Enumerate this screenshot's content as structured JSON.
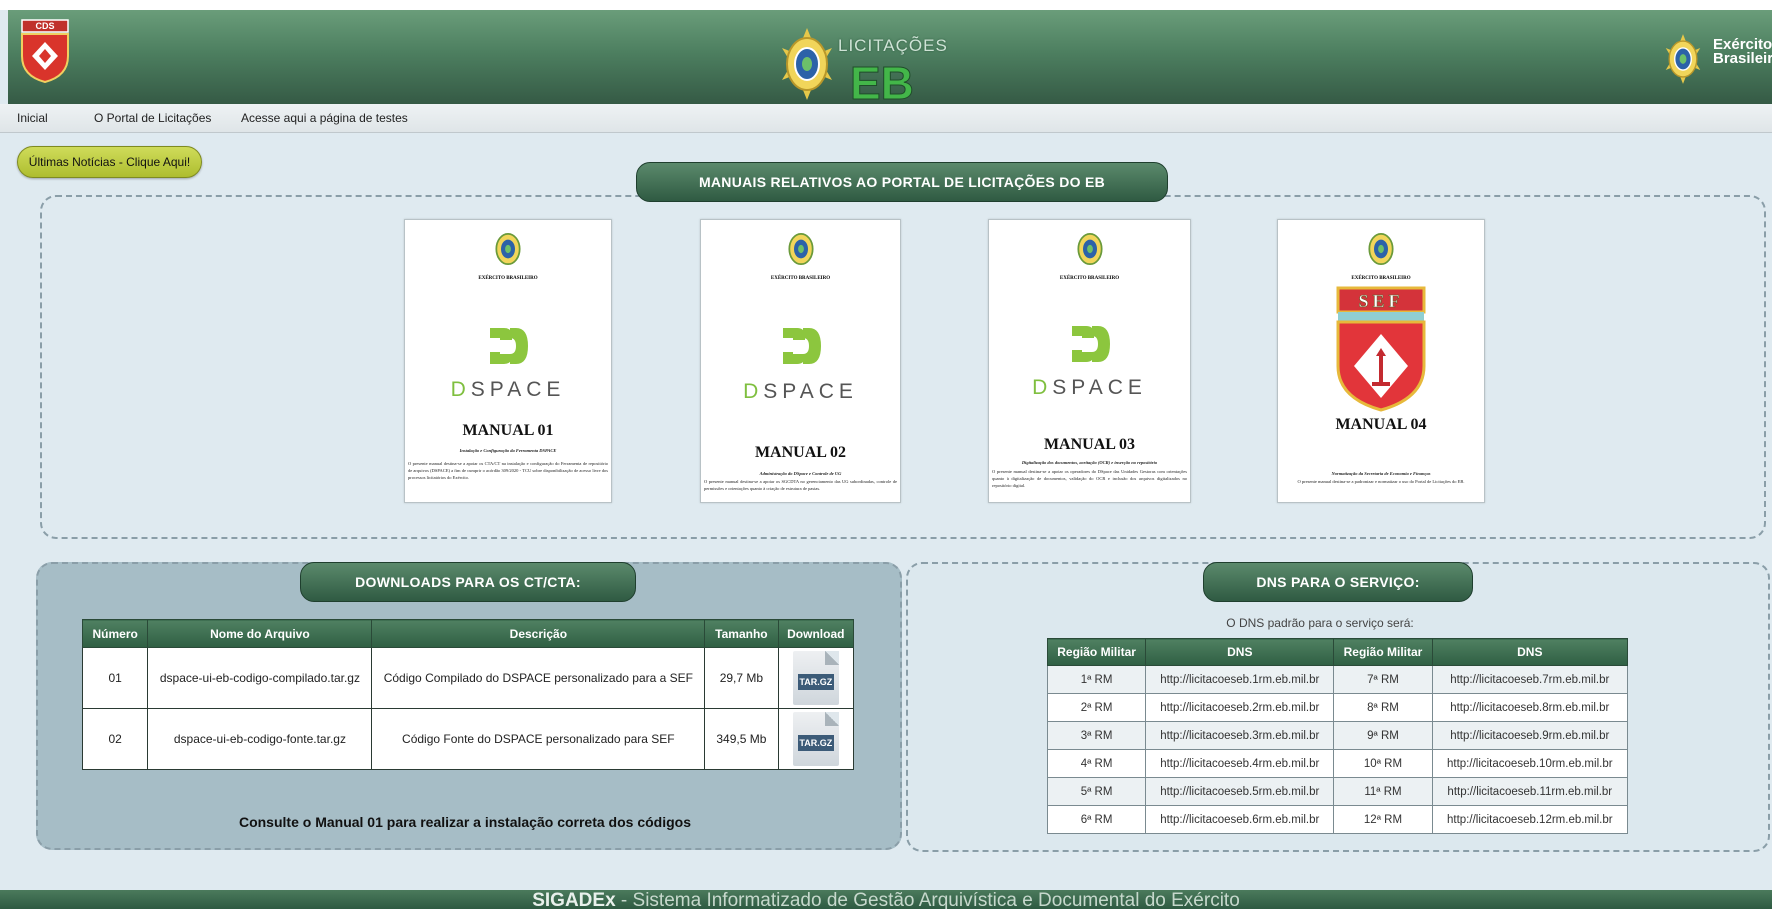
{
  "header": {
    "cds_logo_text": "CDS",
    "brand_small": "LICITAÇÕES",
    "brand_big": "EB",
    "exercito_line1": "Exército",
    "exercito_line2": "Brasileiro"
  },
  "nav": {
    "items": [
      "Inicial",
      "O Portal de Licitações",
      "Acesse aqui a página de testes"
    ]
  },
  "news_button": "Últimas Notícias - Clique Aqui!",
  "manuals": {
    "title": "MANUAIS RELATIVOS AO PORTAL DE LICITAÇÕES DO EB",
    "cards": [
      {
        "header": "EXÉRCITO BRASILEIRO",
        "logo": "DSPACE",
        "title": "MANUAL 01",
        "subtitle": "Instalação e Configuração da Ferramenta DSPACE",
        "description": "O presente manual destina-se a apoiar os CTA/CT na instalação e configuração do Ferramenta de repositório de arquivos (DSPACE) a fim de cumprir o acórdão 309/2020 - TCU sobre disponibilização de acesso livre dos processos licitatórios do Exército."
      },
      {
        "header": "EXÉRCITO BRASILEIRO",
        "logo": "DSPACE",
        "title": "MANUAL 02",
        "subtitle": "Administração do DSpace e Controle de UG",
        "description": "O presente manual destina-se a apoiar os SGCDTA no gerenciamento das UG subordinadas, controle de permissões e orientações quanto à criação de estrutura de pastas."
      },
      {
        "header": "EXÉRCITO BRASILEIRO",
        "logo": "DSPACE",
        "title": "MANUAL 03",
        "subtitle": "Digitalização dos documentos, aceitação (OCR) e inserção no repositório",
        "description": "O presente manual destina-se a apoiar os operadores do DSpace das Unidades Gestoras com orientações quanto à digitalização de documentos, validação do OCR e inclusão dos arquivos digitalizados no repositório digital."
      },
      {
        "header": "EXÉRCITO BRASILEIRO",
        "logo": "SEF",
        "title": "MANUAL 04",
        "subtitle": "Normatização da Secretaria de Economia e Finanças",
        "description": "O presente manual destina-se a padronizar e normatizar o uso do Portal de Licitações do EB."
      }
    ]
  },
  "downloads": {
    "title": "DOWNLOADS PARA OS CT/CTA:",
    "columns": [
      "Número",
      "Nome do Arquivo",
      "Descrição",
      "Tamanho",
      "Download"
    ],
    "rows": [
      [
        "01",
        "dspace-ui-eb-codigo-compilado.tar.gz",
        "Código Compilado do DSPACE personalizado para a SEF",
        "29,7 Mb",
        "TAR.GZ"
      ],
      [
        "02",
        "dspace-ui-eb-codigo-fonte.tar.gz",
        "Código Fonte do DSPACE personalizado para SEF",
        "349,5 Mb",
        "TAR.GZ"
      ]
    ],
    "note": "Consulte o Manual 01 para realizar a instalação correta dos códigos"
  },
  "dns": {
    "title": "DNS PARA O SERVIÇO:",
    "intro": "O DNS padrão para o serviço será:",
    "columns": [
      "Região Militar",
      "DNS",
      "Região Militar",
      "DNS"
    ],
    "rows": [
      [
        "1ª RM",
        "http://licitacoeseb.1rm.eb.mil.br",
        "7ª RM",
        "http://licitacoeseb.7rm.eb.mil.br"
      ],
      [
        "2ª RM",
        "http://licitacoeseb.2rm.eb.mil.br",
        "8ª RM",
        "http://licitacoeseb.8rm.eb.mil.br"
      ],
      [
        "3ª RM",
        "http://licitacoeseb.3rm.eb.mil.br",
        "9ª RM",
        "http://licitacoeseb.9rm.eb.mil.br"
      ],
      [
        "4ª RM",
        "http://licitacoeseb.4rm.eb.mil.br",
        "10ª RM",
        "http://licitacoeseb.10rm.eb.mil.br"
      ],
      [
        "5ª RM",
        "http://licitacoeseb.5rm.eb.mil.br",
        "11ª RM",
        "http://licitacoeseb.11rm.eb.mil.br"
      ],
      [
        "6ª RM",
        "http://licitacoeseb.6rm.eb.mil.br",
        "12ª RM",
        "http://licitacoeseb.12rm.eb.mil.br"
      ]
    ]
  },
  "footer": {
    "strong": "SIGADEx",
    "text": " - Sistema Informatizado de Gestão Arquivística e Documental do Exército"
  },
  "colors": {
    "header_green": "#4d7f60",
    "pill_green": "#2f5a42",
    "news_button": "#bfcc3f",
    "downloads_bg": "#a6bdc6",
    "page_bg": "#dfeaf0"
  }
}
